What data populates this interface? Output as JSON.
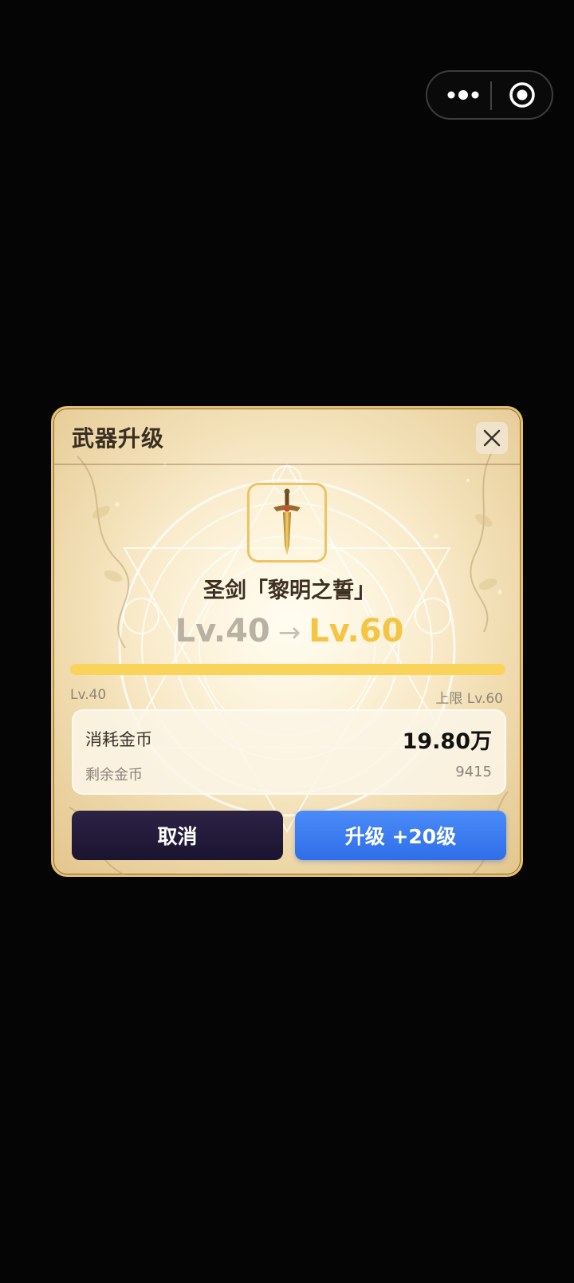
{
  "capsule": {
    "more_icon": "more-dots-icon",
    "close_icon": "target-circle-icon"
  },
  "dialog": {
    "title": "武器升级",
    "close_icon": "close-icon",
    "weapon_icon": "sword-icon",
    "weapon_name": "圣剑「黎明之誓」",
    "level_from": "Lv.40",
    "level_arrow": "→",
    "level_to": "Lv.60",
    "progress_fraction": 1.0,
    "progress_min_label": "Lv.40",
    "progress_max_label": "上限 Lv.60",
    "cost": {
      "label": "消耗金币",
      "value": "19.80万",
      "remaining_label": "剩余金币",
      "remaining_value": "9415"
    },
    "buttons": {
      "cancel": "取消",
      "upgrade": "升级 +20级"
    }
  },
  "colors": {
    "accent_gold": "#f5c443",
    "upgrade_blue": "#3a7cf2",
    "cancel_dark": "#231b3b"
  }
}
